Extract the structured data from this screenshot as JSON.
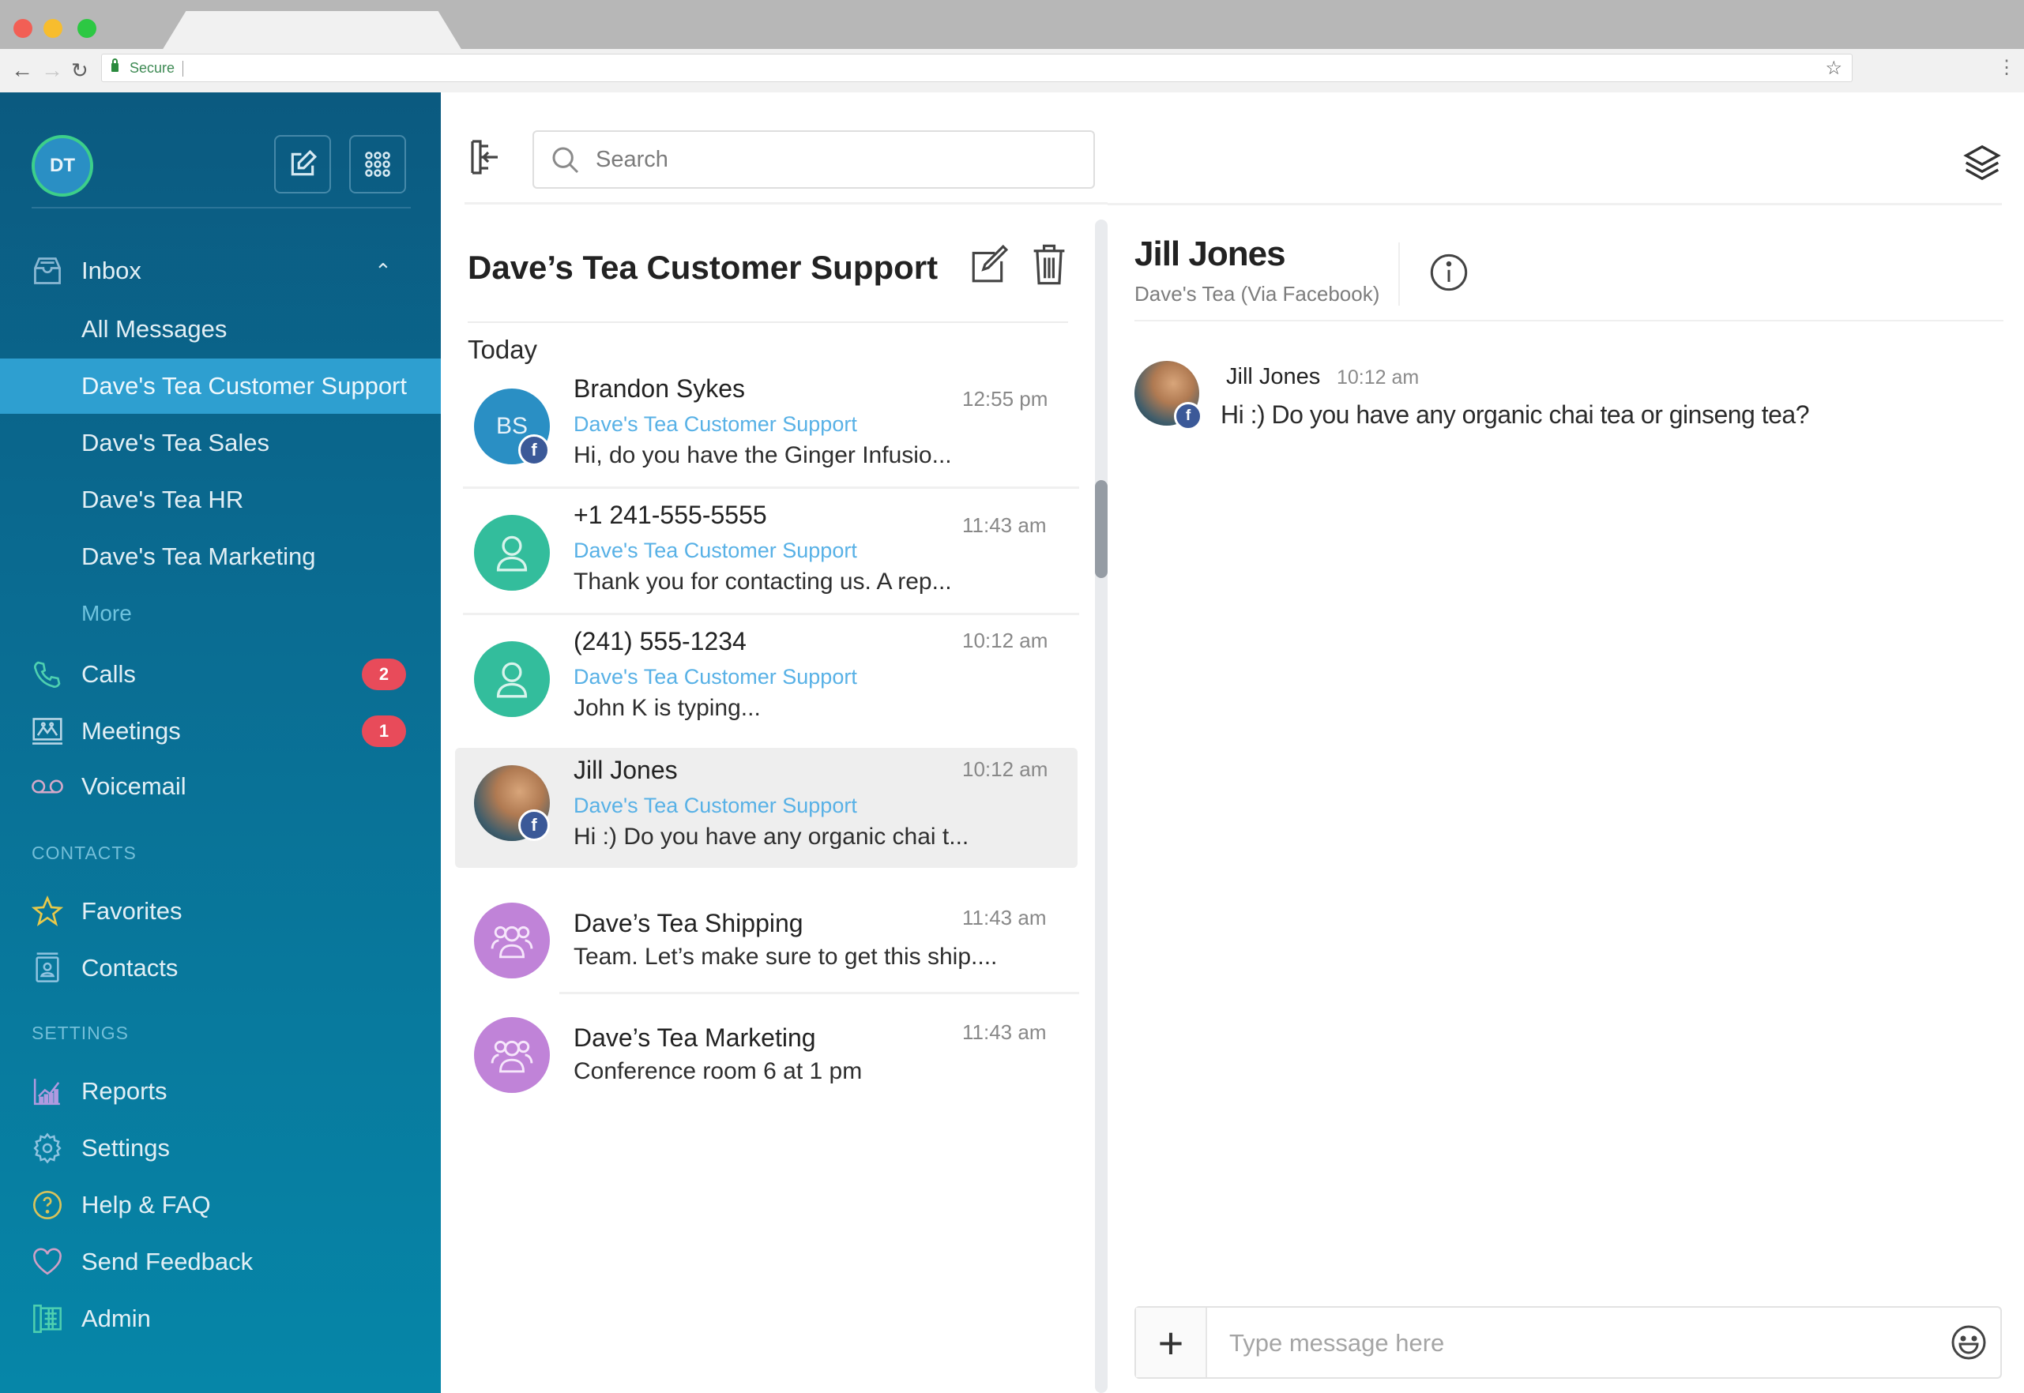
{
  "browser": {
    "address": {
      "secure_label": "Secure",
      "url": ""
    }
  },
  "colors": {
    "sidebar_top": "#0b5a80",
    "sidebar_bottom": "#0686a8",
    "sidebar_active": "#2e9fd0",
    "badge": "#e84b5a",
    "link_blue": "#58b1e6",
    "facebook": "#3b5998",
    "avatar_blue": "#2a8fc4",
    "avatar_teal": "#33bd9c",
    "avatar_purple": "#c083d8"
  },
  "sidebar": {
    "user_initials": "DT",
    "inbox": {
      "label": "Inbox",
      "expanded": true,
      "items": [
        {
          "label": "All Messages",
          "active": false
        },
        {
          "label": "Dave's Tea Customer Support",
          "active": true
        },
        {
          "label": "Dave's Tea Sales",
          "active": false
        },
        {
          "label": "Dave's Tea HR",
          "active": false
        },
        {
          "label": "Dave's Tea Marketing",
          "active": false
        }
      ],
      "more_label": "More"
    },
    "main_items": [
      {
        "label": "Calls",
        "icon": "phone-icon",
        "badge": "2"
      },
      {
        "label": "Meetings",
        "icon": "meetings-icon",
        "badge": "1"
      },
      {
        "label": "Voicemail",
        "icon": "voicemail-icon",
        "badge": null
      }
    ],
    "contacts_section": {
      "title": "CONTACTS",
      "items": [
        {
          "label": "Favorites",
          "icon": "star-icon"
        },
        {
          "label": "Contacts",
          "icon": "contact-card-icon"
        }
      ]
    },
    "settings_section": {
      "title": "SETTINGS",
      "items": [
        {
          "label": "Reports",
          "icon": "bar-chart-icon"
        },
        {
          "label": "Settings",
          "icon": "gear-icon"
        },
        {
          "label": "Help & FAQ",
          "icon": "help-icon"
        },
        {
          "label": "Send Feedback",
          "icon": "heart-icon"
        },
        {
          "label": "Admin",
          "icon": "admin-icon"
        }
      ]
    }
  },
  "middle": {
    "search_placeholder": "Search",
    "search_value": "",
    "title": "Dave’s Tea Customer Support",
    "group_label": "Today",
    "conversations": [
      {
        "name": "Brandon Sykes",
        "initials": "BS",
        "avatar": "initials-blue",
        "facebook": true,
        "inbox": "Dave's Tea Customer Support",
        "preview": "Hi, do you have the Ginger Infusio...",
        "time": "12:55 pm",
        "selected": false
      },
      {
        "name": "+1 241-555-5555",
        "initials": "",
        "avatar": "person-teal",
        "facebook": false,
        "inbox": "Dave's Tea Customer Support",
        "preview": "Thank you for contacting us. A rep...",
        "time": "11:43 am",
        "selected": false
      },
      {
        "name": "(241) 555-1234",
        "initials": "",
        "avatar": "person-teal",
        "facebook": false,
        "inbox": "Dave's Tea Customer Support",
        "preview": "John K is typing...",
        "time": "10:12 am",
        "selected": false
      },
      {
        "name": "Jill Jones",
        "initials": "",
        "avatar": "photo",
        "facebook": true,
        "inbox": "Dave's Tea Customer Support",
        "preview": "Hi :) Do you have any organic chai t...",
        "time": "10:12 am",
        "selected": true
      },
      {
        "name": "Dave’s Tea Shipping",
        "initials": "",
        "avatar": "group-purple",
        "facebook": false,
        "inbox": "",
        "preview": "Team.  Let’s make sure to get this ship....",
        "time": "11:43 am",
        "selected": false
      },
      {
        "name": "Dave’s Tea Marketing",
        "initials": "",
        "avatar": "group-purple",
        "facebook": false,
        "inbox": "",
        "preview": "Conference room 6 at 1 pm",
        "time": "11:43 am",
        "selected": false
      }
    ]
  },
  "chat": {
    "contact_name": "Jill Jones",
    "contact_sub": "Dave's Tea (Via Facebook)",
    "messages": [
      {
        "author": "Jill Jones",
        "time": "10:12 am",
        "text": "Hi :) Do you have any organic chai tea or ginseng tea?",
        "facebook": true
      }
    ],
    "composer_placeholder": "Type message here",
    "composer_value": "",
    "attach_label": "+"
  }
}
